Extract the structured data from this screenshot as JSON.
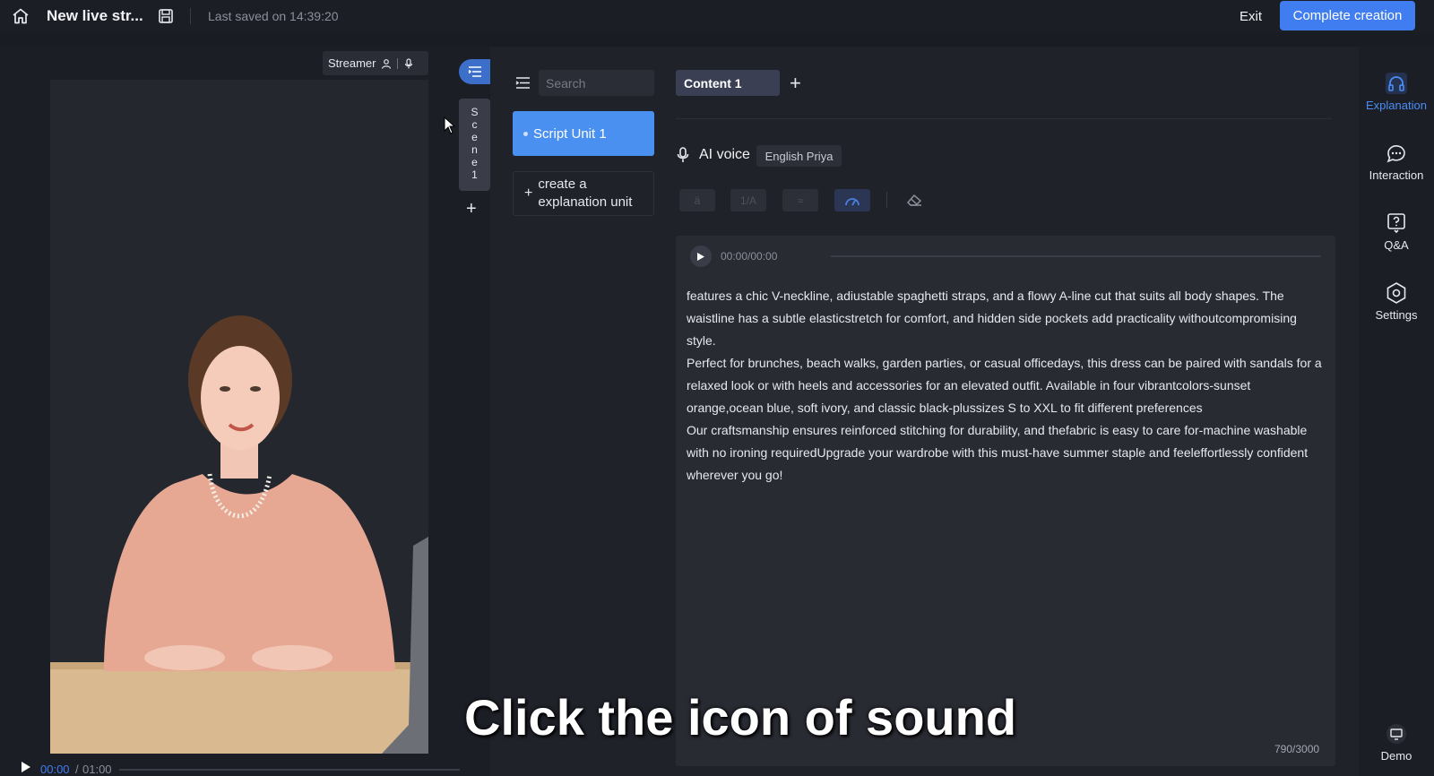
{
  "header": {
    "title": "New live str...",
    "saved_text": "Last saved on 14:39:20",
    "exit_label": "Exit",
    "complete_label": "Complete creation",
    "accent_color": "#3f7df0"
  },
  "preview": {
    "streamer_label": "Streamer",
    "scene_label": [
      "S",
      "c",
      "e",
      "n",
      "e",
      "1"
    ],
    "scene_add": "+",
    "time_current": "00:00",
    "time_separator": "/",
    "time_total": "01:00"
  },
  "units": {
    "search_placeholder": "Search",
    "script_unit_label": "Script Unit 1",
    "create_unit_label": "create a explanation unit",
    "create_unit_plus": "+"
  },
  "editor": {
    "tab_label": "Content 1",
    "tab_add": "+",
    "voice_label": "AI voice",
    "voice_name": "English Priya",
    "tools": [
      "ä",
      "1/A",
      "≈",
      "speed-icon"
    ],
    "audio_time": "00:00/00:00",
    "paragraphs": [
      "features a chic V-neckline, adiustable spaghetti straps, and a flowy A-line cut that suits all body shapes. The waistline has a subtle elasticstretch for comfort, and hidden side pockets add practicality withoutcompromising style.",
      "Perfect for brunches, beach walks, garden parties, or casual officedays, this dress can be paired with sandals for a relaxed look or with heels and accessories for an elevated outfit. Available in four vibrantcolors-sunset orange,ocean blue, soft ivory, and classic black-plussizes S to XXL to fit different preferences",
      "Our craftsmanship ensures reinforced stitching for durability, and thefabric is easy to care for-machine washable with no ironing requiredUpgrade your wardrobe with this must-have summer staple and feeleffortlessly confident wherever you go!"
    ],
    "char_count": "790/3000"
  },
  "caption": "Click the icon of sound",
  "rail": {
    "items": [
      {
        "label": "Explanation",
        "icon": "headphones-icon"
      },
      {
        "label": "Interaction",
        "icon": "chat-icon"
      },
      {
        "label": "Q&A",
        "icon": "question-icon"
      },
      {
        "label": "Settings",
        "icon": "hexagon-settings-icon"
      },
      {
        "label": "Demo",
        "icon": "screen-icon"
      }
    ]
  }
}
